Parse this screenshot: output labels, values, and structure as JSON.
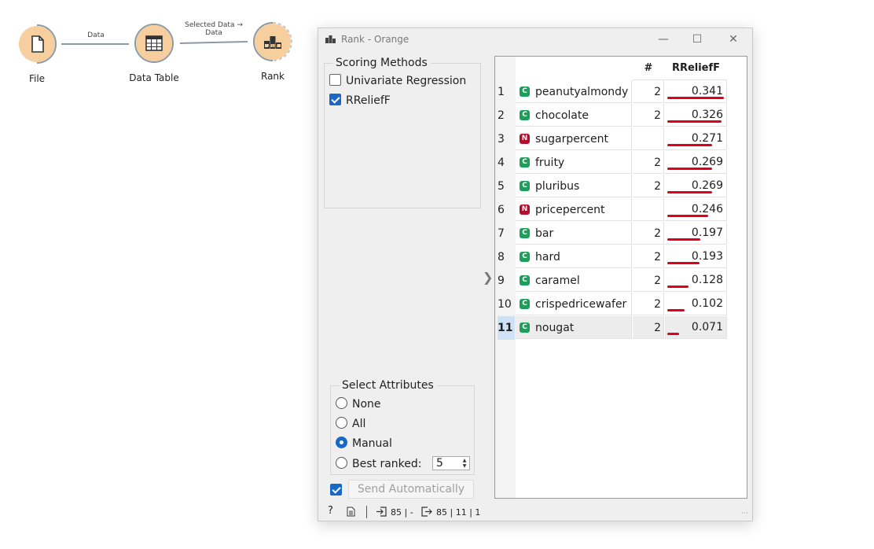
{
  "workflow": {
    "nodes": [
      {
        "label": "File",
        "icon": "file-icon"
      },
      {
        "label": "Data Table",
        "icon": "table-icon"
      },
      {
        "label": "Rank",
        "icon": "rank-icon"
      }
    ],
    "links": [
      {
        "label": "Data"
      },
      {
        "label_line1": "Selected Data →",
        "label_line2": "Data"
      }
    ],
    "rank_icon_text": "2 1 3"
  },
  "window": {
    "title": "Rank - Orange",
    "minimize": "—",
    "maximize": "☐",
    "close": "✕"
  },
  "scoring": {
    "title": "Scoring Methods",
    "methods": [
      {
        "label": "Univariate Regression",
        "checked": false
      },
      {
        "label": "RReliefF",
        "checked": true
      }
    ]
  },
  "select_attributes": {
    "title": "Select Attributes",
    "options": [
      "None",
      "All",
      "Manual",
      "Best ranked:"
    ],
    "selected": "Manual",
    "best_ranked_value": "5"
  },
  "send": {
    "label": "Send Automatically",
    "checked": true
  },
  "table": {
    "headers": {
      "count": "#",
      "score": "RReliefF"
    },
    "rows": [
      {
        "num": "1",
        "type": "C",
        "name": "peanutyalmondy",
        "count": "2",
        "score": "0.341",
        "value": 0.341
      },
      {
        "num": "2",
        "type": "C",
        "name": "chocolate",
        "count": "2",
        "score": "0.326",
        "value": 0.326
      },
      {
        "num": "3",
        "type": "N",
        "name": "sugarpercent",
        "count": "",
        "score": "0.271",
        "value": 0.271
      },
      {
        "num": "4",
        "type": "C",
        "name": "fruity",
        "count": "2",
        "score": "0.269",
        "value": 0.269
      },
      {
        "num": "5",
        "type": "C",
        "name": "pluribus",
        "count": "2",
        "score": "0.269",
        "value": 0.269
      },
      {
        "num": "6",
        "type": "N",
        "name": "pricepercent",
        "count": "",
        "score": "0.246",
        "value": 0.246
      },
      {
        "num": "7",
        "type": "C",
        "name": "bar",
        "count": "2",
        "score": "0.197",
        "value": 0.197
      },
      {
        "num": "8",
        "type": "C",
        "name": "hard",
        "count": "2",
        "score": "0.193",
        "value": 0.193
      },
      {
        "num": "9",
        "type": "C",
        "name": "caramel",
        "count": "2",
        "score": "0.128",
        "value": 0.128
      },
      {
        "num": "10",
        "type": "C",
        "name": "crispedricewafer",
        "count": "2",
        "score": "0.102",
        "value": 0.102
      },
      {
        "num": "11",
        "type": "C",
        "name": "nougat",
        "count": "2",
        "score": "0.071",
        "value": 0.071
      }
    ],
    "selected_row": "11",
    "bar_color": "#e0001b"
  },
  "status": {
    "help": "?",
    "input": "85 | -",
    "output": "85 | 11 | 1"
  },
  "colors": {
    "node_fill": "#f7cf9f",
    "checkbox_blue": "#1868c9"
  }
}
